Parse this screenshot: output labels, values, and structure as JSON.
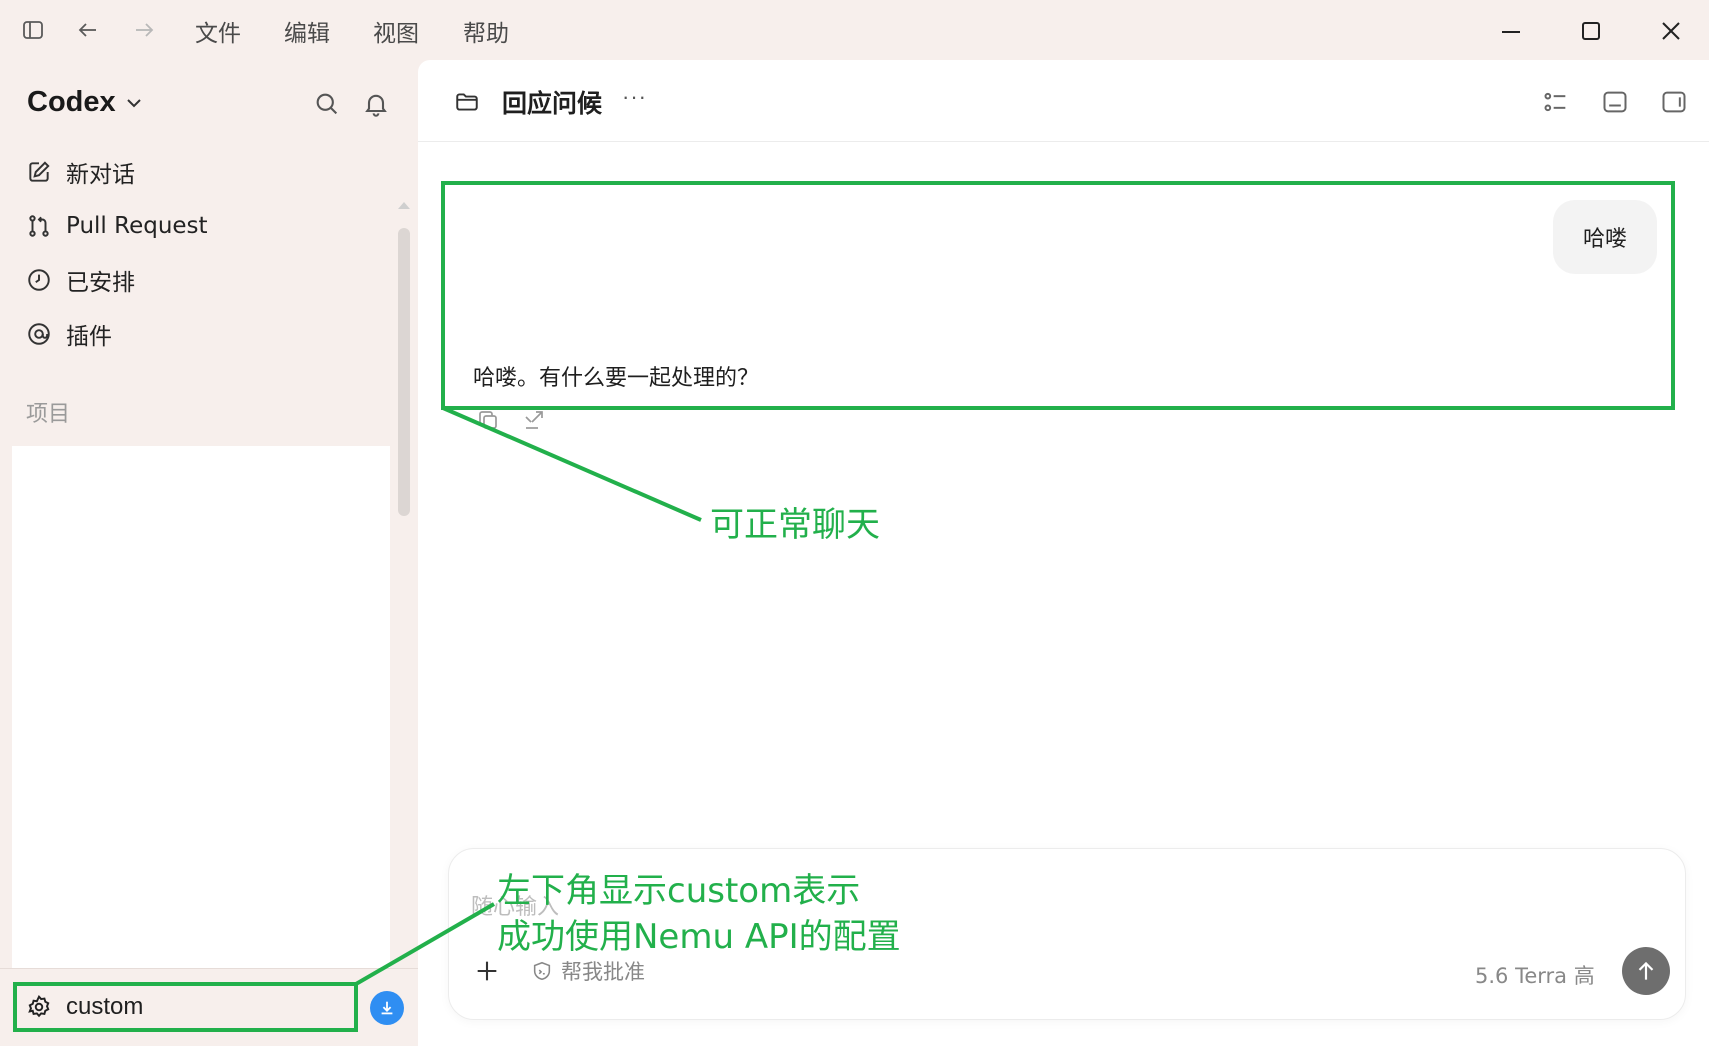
{
  "menu": {
    "items": [
      "文件",
      "编辑",
      "视图",
      "帮助"
    ]
  },
  "sidebar": {
    "brand": "Codex",
    "nav": [
      {
        "label": "新对话",
        "icon": "edit-icon"
      },
      {
        "label": "Pull Request",
        "icon": "git-pull-request-icon"
      },
      {
        "label": "已安排",
        "icon": "clock-icon"
      },
      {
        "label": "插件",
        "icon": "plugin-icon"
      }
    ],
    "section_label": "项目",
    "profile_label": "custom"
  },
  "chat": {
    "title": "回应问候",
    "more": "···",
    "user_message": "哈喽",
    "assistant_message": "哈喽。有什么要一起处理的？"
  },
  "composer": {
    "placeholder": "随心输入",
    "approve_label": "帮我批准",
    "model_label": "5.6 Terra  高"
  },
  "annotations": {
    "chat_note": "可正常聊天",
    "custom_note_line1": "左下角显示custom表示",
    "custom_note_line2": "成功使用Nemu API的配置",
    "color": "#22b04b"
  },
  "colors": {
    "sidebar_bg": "#f7efec",
    "main_bg": "#ffffff",
    "accent_blue": "#2f8ef2",
    "send_button": "#6e6e6e"
  }
}
